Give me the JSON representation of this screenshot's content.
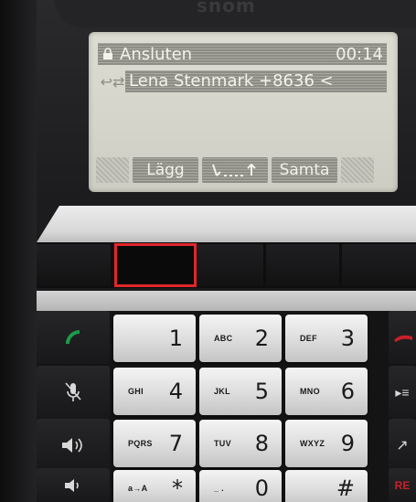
{
  "device": {
    "brand": "snom"
  },
  "lcd": {
    "status": "Ansluten",
    "timer": "00:14",
    "caller": "Lena Stenmark +8636 <",
    "softkeys": [
      "Lägg",
      "",
      "Samta"
    ]
  },
  "keypad": {
    "keys": [
      {
        "letters": "",
        "number": "1"
      },
      {
        "letters": "ABC",
        "number": "2"
      },
      {
        "letters": "DEF",
        "number": "3"
      },
      {
        "letters": "GHI",
        "number": "4"
      },
      {
        "letters": "JKL",
        "number": "5"
      },
      {
        "letters": "MNO",
        "number": "6"
      },
      {
        "letters": "PQRS",
        "number": "7"
      },
      {
        "letters": "TUV",
        "number": "8"
      },
      {
        "letters": "WXYZ",
        "number": "9"
      },
      {
        "letters": "a→A",
        "number": "*"
      },
      {
        "letters": "_ .",
        "number": "0"
      },
      {
        "letters": "",
        "number": "#"
      }
    ],
    "right_partial_label": "RE"
  },
  "colors": {
    "highlight": "#e0262a",
    "call_green": "#1f9a4a",
    "end_red": "#c8202a"
  }
}
